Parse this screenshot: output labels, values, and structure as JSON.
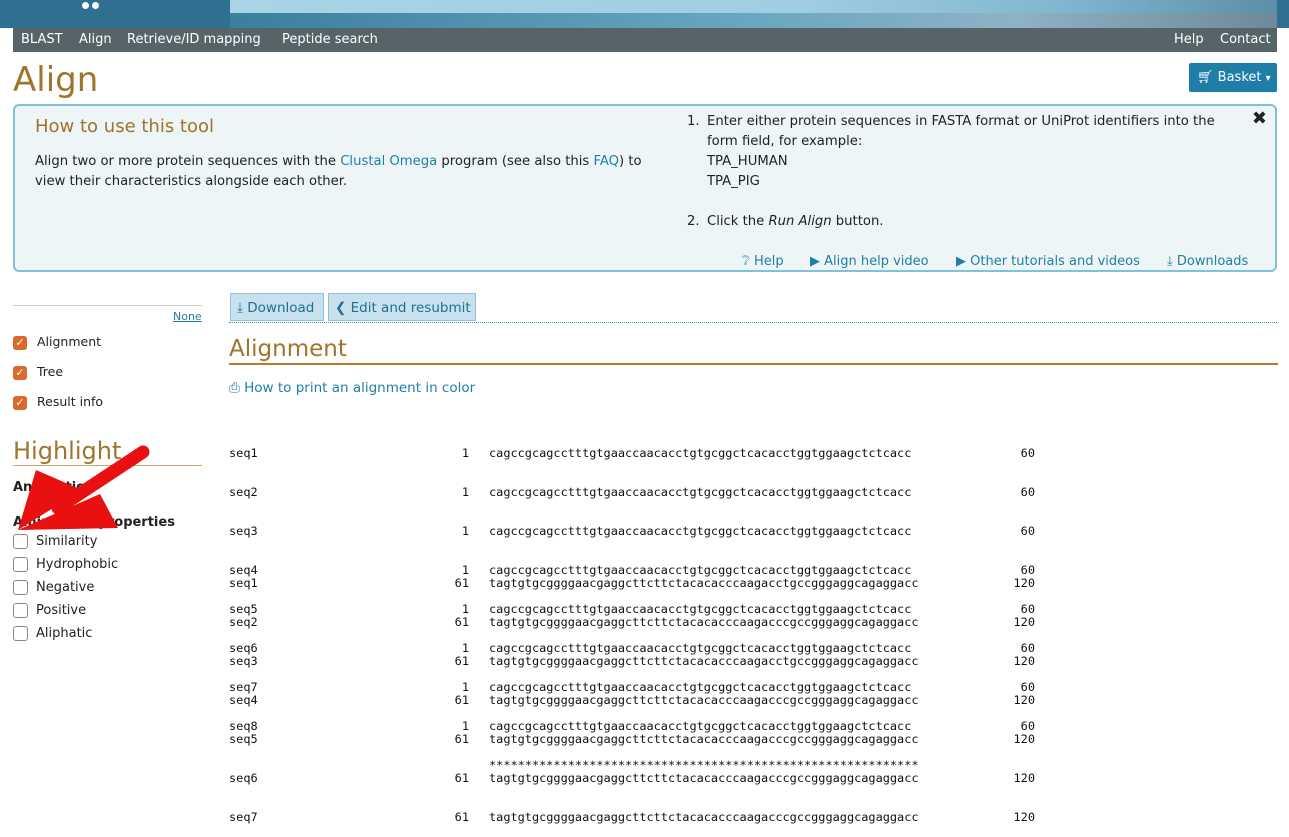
{
  "nav": {
    "left": [
      "BLAST",
      "Align",
      "Retrieve/ID mapping",
      "Peptide search"
    ],
    "right": [
      "Help",
      "Contact"
    ]
  },
  "page_title": "Align",
  "basket_label": "Basket",
  "help_box": {
    "title": "How to use this tool",
    "text_before": "Align two or more protein sequences with the ",
    "link_clustal": "Clustal Omega",
    "text_middle": " program (see also this ",
    "link_faq": "FAQ",
    "text_after": ") to view their characteristics alongside each other.",
    "step1_num": "1.",
    "step1_text": "Enter either protein sequences in FASTA format or UniProt identifiers into the form field, for example:",
    "example1": "TPA_HUMAN",
    "example2": "TPA_PIG",
    "step2_num": "2.",
    "step2_prefix": "Click the ",
    "step2_em": "Run Align",
    "step2_suffix": " button.",
    "links": [
      "Help",
      "Align help video",
      "Other tutorials and videos",
      "Downloads"
    ]
  },
  "sidebar": {
    "none_link": "None",
    "sections": [
      "Alignment",
      "Tree",
      "Result info"
    ],
    "highlight_title": "Highlight",
    "annotation_label": "Annotation",
    "amino_label": "Amino acid properties",
    "properties": [
      "Similarity",
      "Hydrophobic",
      "Negative",
      "Positive",
      "Aliphatic"
    ]
  },
  "toolbar": {
    "download_label": "Download",
    "edit_label": "Edit and resubmit"
  },
  "alignment": {
    "title": "Alignment",
    "print_link": "How to print an alignment in color",
    "blocks": [
      {
        "rows": [
          {
            "name": "seq1",
            "start": "1",
            "seq": "cagccgcagcctttgtgaaccaacacctgtgcggctcacacctggtggaagctctcacc",
            "end": "60"
          },
          {
            "name": "seq2",
            "start": "1",
            "seq": "cagccgcagcctttgtgaaccaacacctgtgcggctcacacctggtggaagctctcacc",
            "end": "60"
          },
          {
            "name": "seq3",
            "start": "1",
            "seq": "cagccgcagcctttgtgaaccaacacctgtgcggctcacacctggtggaagctctcacc",
            "end": "60"
          },
          {
            "name": "seq4",
            "start": "1",
            "seq": "cagccgcagcctttgtgaaccaacacctgtgcggctcacacctggtggaagctctcacc",
            "end": "60"
          },
          {
            "name": "seq5",
            "start": "1",
            "seq": "cagccgcagcctttgtgaaccaacacctgtgcggctcacacctggtggaagctctcacc",
            "end": "60"
          },
          {
            "name": "seq6",
            "start": "1",
            "seq": "cagccgcagcctttgtgaaccaacacctgtgcggctcacacctggtggaagctctcacc",
            "end": "60"
          },
          {
            "name": "seq7",
            "start": "1",
            "seq": "cagccgcagcctttgtgaaccaacacctgtgcggctcacacctggtggaagctctcacc",
            "end": "60"
          },
          {
            "name": "seq8",
            "start": "1",
            "seq": "cagccgcagcctttgtgaaccaacacctgtgcggctcacacctggtggaagctctcacc",
            "end": "60"
          }
        ],
        "consensus": "************************************************************"
      },
      {
        "rows": [
          {
            "name": "seq1",
            "start": "61",
            "seq": "tagtgtgcggggaacgaggcttcttctacacacccaagacctgccgggaggcagaggacc",
            "end": "120"
          },
          {
            "name": "seq2",
            "start": "61",
            "seq": "tagtgtgcggggaacgaggcttcttctacacacccaagacccgccgggaggcagaggacc",
            "end": "120"
          },
          {
            "name": "seq3",
            "start": "61",
            "seq": "tagtgtgcggggaacgaggcttcttctacacacccaagacctgccgggaggcagaggacc",
            "end": "120"
          },
          {
            "name": "seq4",
            "start": "61",
            "seq": "tagtgtgcggggaacgaggcttcttctacacacccaagacccgccgggaggcagaggacc",
            "end": "120"
          },
          {
            "name": "seq5",
            "start": "61",
            "seq": "tagtgtgcggggaacgaggcttcttctacacacccaagacccgccgggaggcagaggacc",
            "end": "120"
          },
          {
            "name": "seq6",
            "start": "61",
            "seq": "tagtgtgcggggaacgaggcttcttctacacacccaagacccgccgggaggcagaggacc",
            "end": "120"
          },
          {
            "name": "seq7",
            "start": "61",
            "seq": "tagtgtgcggggaacgaggcttcttctacacacccaagacccgccgggaggcagaggacc",
            "end": "120"
          }
        ]
      }
    ]
  },
  "colors": {
    "accent": "#a0742c",
    "link": "#1f7ea8",
    "nav_bg": "#566469",
    "checkbox": "#d96a2b",
    "arrow": "#e81010"
  }
}
